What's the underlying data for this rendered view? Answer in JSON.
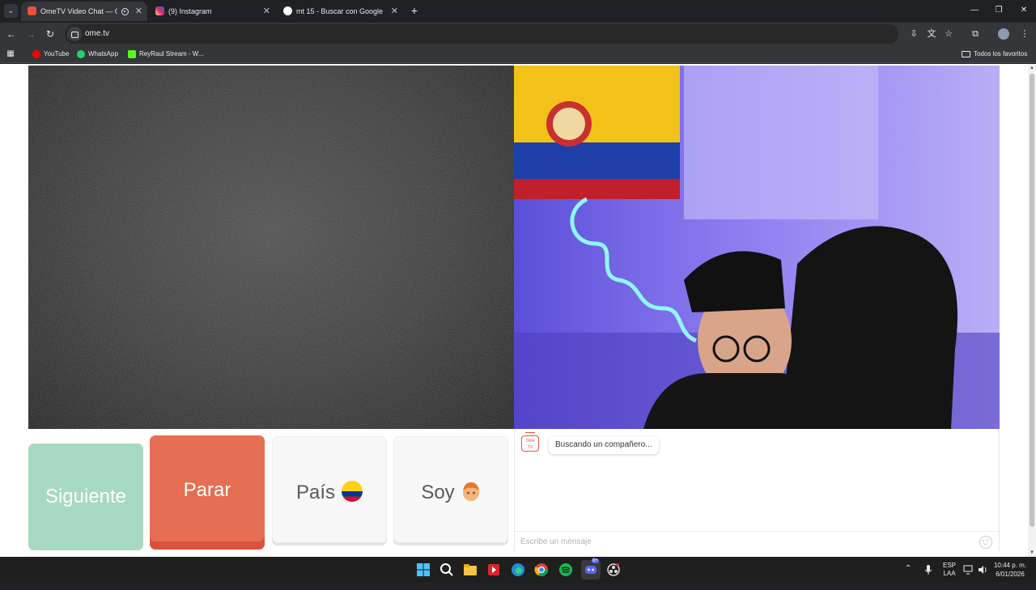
{
  "browser": {
    "tabs": [
      {
        "title": "OmeTV Video Chat — Ome",
        "active": true,
        "recording": true
      },
      {
        "title": "(9) Instagram",
        "active": false
      },
      {
        "title": "mt 15 - Buscar con Google",
        "active": false
      }
    ],
    "url": "ome.tv",
    "bookmarks": [
      {
        "label": "YouTube",
        "icon": "youtube-icon",
        "color": "#ff0000"
      },
      {
        "label": "WhatsApp",
        "icon": "whatsapp-icon",
        "color": "#25d366"
      },
      {
        "label": "ReyRaul Stream - W...",
        "icon": "kick-icon",
        "color": "#53fc18"
      }
    ],
    "all_bookmarks_label": "Todos los favoritos"
  },
  "app": {
    "controls": {
      "next_label": "Siguiente",
      "stop_label": "Parar",
      "country_label": "País",
      "country_flag": "colombia-flag-icon",
      "gender_label": "Soy",
      "gender_icon": "boy-face-emoji"
    },
    "chat": {
      "status": "Buscando un compañero...",
      "input_placeholder": "Escribe un mensaje"
    },
    "colors": {
      "next": "#a7d9c0",
      "stop": "#e66e52",
      "neutral": "#f7f7f7"
    }
  },
  "taskbar": {
    "apps": [
      "windows-start-icon",
      "search-icon",
      "file-explorer-icon",
      "app-red-icon",
      "edge-icon",
      "chrome-icon",
      "spotify-icon",
      "discord-icon",
      "obs-icon"
    ],
    "discord_badge": "9+",
    "lang_line1": "ESP",
    "lang_line2": "LAA",
    "time": "10:44 p. m.",
    "date": "6/01/2026"
  }
}
